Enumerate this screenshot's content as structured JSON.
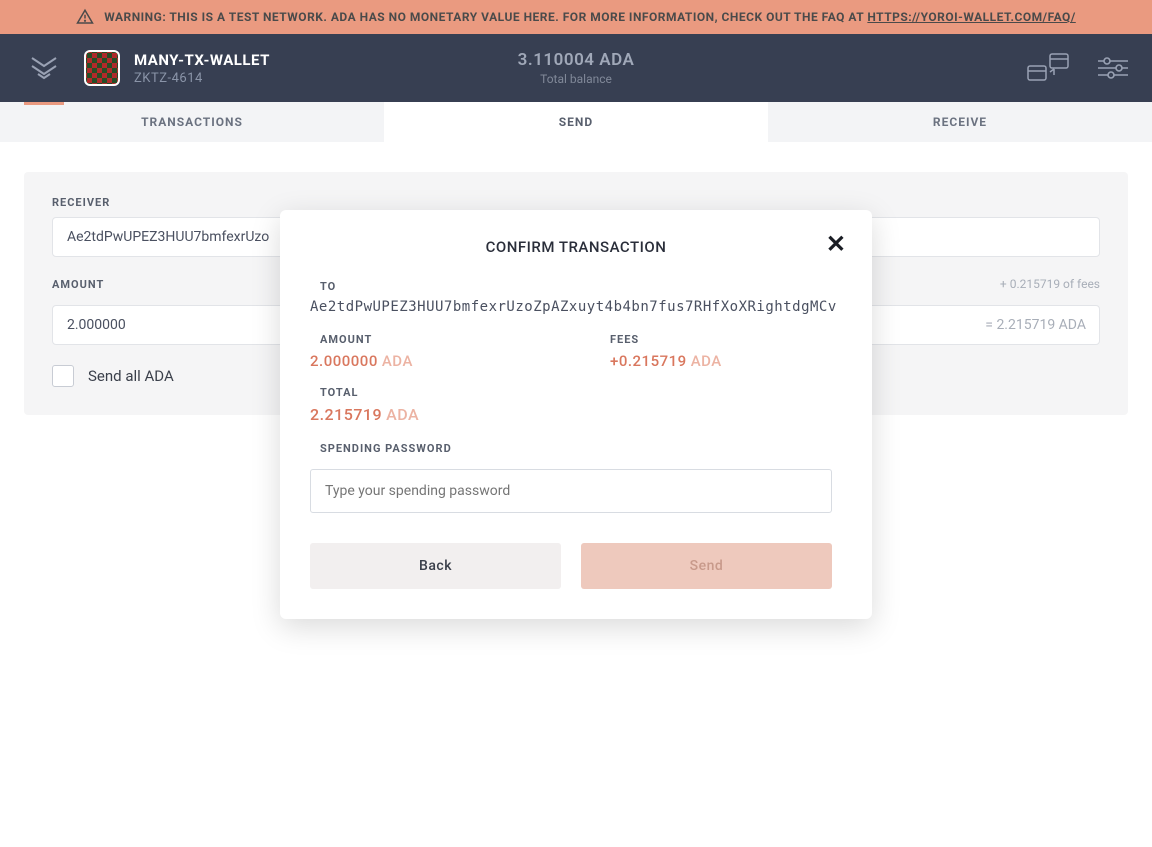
{
  "warning": {
    "text_prefix": "WARNING: THIS IS A TEST NETWORK. ADA HAS NO MONETARY VALUE HERE. FOR MORE INFORMATION, CHECK OUT THE FAQ AT ",
    "link_text": "HTTPS://YOROI-WALLET.COM/FAQ/"
  },
  "header": {
    "wallet_name": "MANY-TX-WALLET",
    "wallet_id": "ZKTZ-4614",
    "balance": "3.110004 ADA",
    "balance_label": "Total balance"
  },
  "tabs": {
    "transactions": "TRANSACTIONS",
    "send": "SEND",
    "receive": "RECEIVE"
  },
  "form": {
    "receiver_label": "RECEIVER",
    "receiver_value": "Ae2tdPwUPEZ3HUU7bmfexrUzo",
    "amount_label": "AMOUNT",
    "amount_value": "2.000000",
    "fees_hint": "+ 0.215719 of fees",
    "amount_total": "= 2.215719 ADA",
    "send_all_label": "Send all ADA"
  },
  "modal": {
    "title": "CONFIRM TRANSACTION",
    "to_label": "TO",
    "to_address": "Ae2tdPwUPEZ3HUU7bmfexrUzoZpAZxuyt4b4bn7fus7RHfXoXRightdgMCv",
    "amount_label": "AMOUNT",
    "amount_num": "2.000000",
    "amount_curr": "ADA",
    "fees_label": "FEES",
    "fees_num": "+0.215719",
    "fees_curr": "ADA",
    "total_label": "TOTAL",
    "total_num": "2.215719",
    "total_curr": "ADA",
    "password_label": "SPENDING PASSWORD",
    "password_placeholder": "Type your spending password",
    "back_label": "Back",
    "send_label": "Send"
  }
}
